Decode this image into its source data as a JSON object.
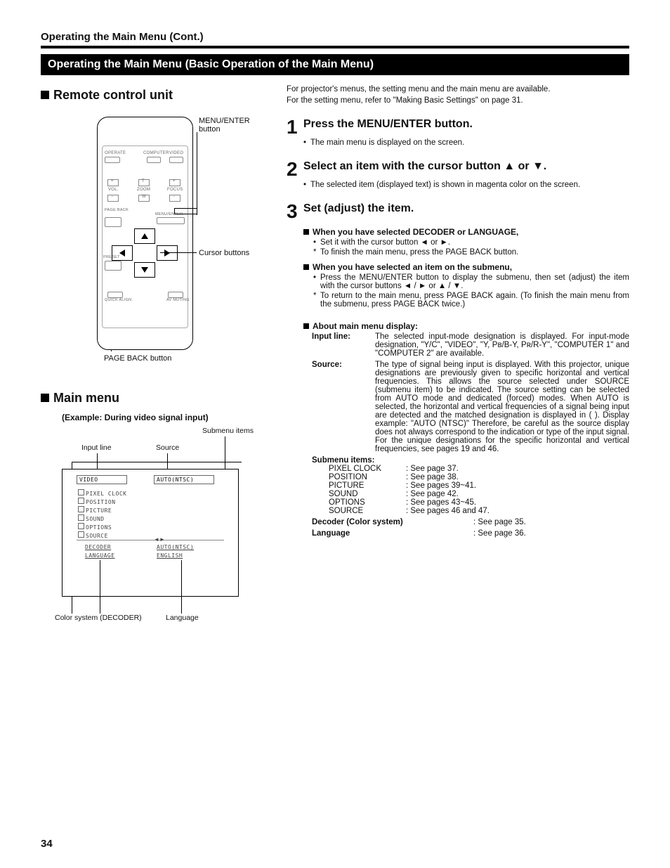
{
  "header": "Operating the Main Menu (Cont.)",
  "black_bar": "Operating the Main Menu (Basic Operation of the Main Menu)",
  "page_number": "34",
  "left": {
    "remote_title": "Remote control unit",
    "callout_menu_enter": "MENU/ENTER button",
    "callout_cursor": "Cursor buttons",
    "callout_pageback": "PAGE BACK button",
    "remote_labels": {
      "operate": "OPERATE",
      "computer": "COMPUTER",
      "video": "VIDEO",
      "vol": "VOL.",
      "zoom": "ZOOM",
      "focus": "FOCUS",
      "plus": "+",
      "minus": "−",
      "t": "T",
      "w": "W",
      "page_back": "PAGE BACK",
      "menu_enter": "MENU/ENTER",
      "preset": "PRESET",
      "quick_align": "QUICK ALIGN.",
      "av_muting": "AV MUTING"
    },
    "main_menu_title": "Main menu",
    "main_menu_example": "(Example: During video signal input)",
    "menu_diagram": {
      "label_submenu": "Submenu items",
      "label_input_line": "Input line",
      "label_source": "Source",
      "label_color_system": "Color system (DECODER)",
      "label_language": "Language",
      "cells": {
        "video": "VIDEO",
        "auto_ntsc": "AUTO(NTSC)",
        "pixel_clock": "PIXEL CLOCK",
        "position": "POSITION",
        "picture": "PICTURE",
        "sound": "SOUND",
        "options": "OPTIONS",
        "source": "SOURCE",
        "decoder": "DECODER",
        "language": "LANGUAGE",
        "decoder_val": "AUTO(NTSC)",
        "language_val": "ENGLISH"
      }
    }
  },
  "right": {
    "intro1": "For projector's menus, the setting menu and the main menu are available.",
    "intro2": "For the setting menu, refer to \"Making Basic Settings\" on page 31.",
    "step1": {
      "title": "Press the MENU/ENTER button.",
      "b1": "The main menu is displayed on the screen."
    },
    "step2": {
      "title": "Select an item with the cursor button ▲ or ▼.",
      "b1": "The selected item (displayed text) is shown in magenta color on the screen."
    },
    "step3": {
      "title": "Set (adjust) the item.",
      "sub1_title": "When you have selected DECODER or LANGUAGE,",
      "sub1_b1": "Set it with the cursor button ◄ or ►.",
      "sub1_s1": "To finish the main menu, press the PAGE BACK button.",
      "sub2_title": "When you have selected an item on the submenu,",
      "sub2_b1": "Press the MENU/ENTER button to display the submenu, then set (adjust) the item with the cursor buttons ◄ / ► or ▲ / ▼.",
      "sub2_s1": "To return to the main menu, press PAGE BACK again. (To finish the main menu from the submenu, press PAGE BACK twice.)"
    },
    "about": {
      "heading": "About main menu display:",
      "input_line_label": "Input line:",
      "input_line_text": "The selected input-mode designation is displayed. For input-mode designation, \"Y/C\", \"VIDEO\", \"Y, Pʙ/B-Y, Pʀ/R-Y\", \"COMPUTER 1\" and \"COMPUTER 2\" are available.",
      "source_label": "Source:",
      "source_text": "The type of signal being input is displayed. With this projector, unique designations are previously given to specific horizontal and vertical frequencies. This allows the source selected under SOURCE (submenu item) to be indicated. The source setting can be selected from AUTO mode and dedicated (forced) modes. When AUTO is selected, the horizontal and vertical frequencies of a signal being input are detected and the matched designation is displayed in (  ). Display example: \"AUTO (NTSC)\" Therefore, be careful as the source display does not always correspond to the indication or type of the input signal. For the unique designations for the specific horizontal and vertical frequencies, see pages 19 and 46.",
      "submenu_label": "Submenu items:",
      "submenu": [
        {
          "k": "PIXEL CLOCK",
          "v": ": See page 37."
        },
        {
          "k": "POSITION",
          "v": ": See page 38."
        },
        {
          "k": "PICTURE",
          "v": ": See pages 39~41."
        },
        {
          "k": "SOUND",
          "v": ": See page 42."
        },
        {
          "k": "OPTIONS",
          "v": ": See pages 43~45."
        },
        {
          "k": "SOURCE",
          "v": ": See pages 46 and 47."
        }
      ],
      "decoder_label": "Decoder (Color system)",
      "decoder_val": ": See page 35.",
      "language_label": "Language",
      "language_val": ": See page 36."
    }
  }
}
